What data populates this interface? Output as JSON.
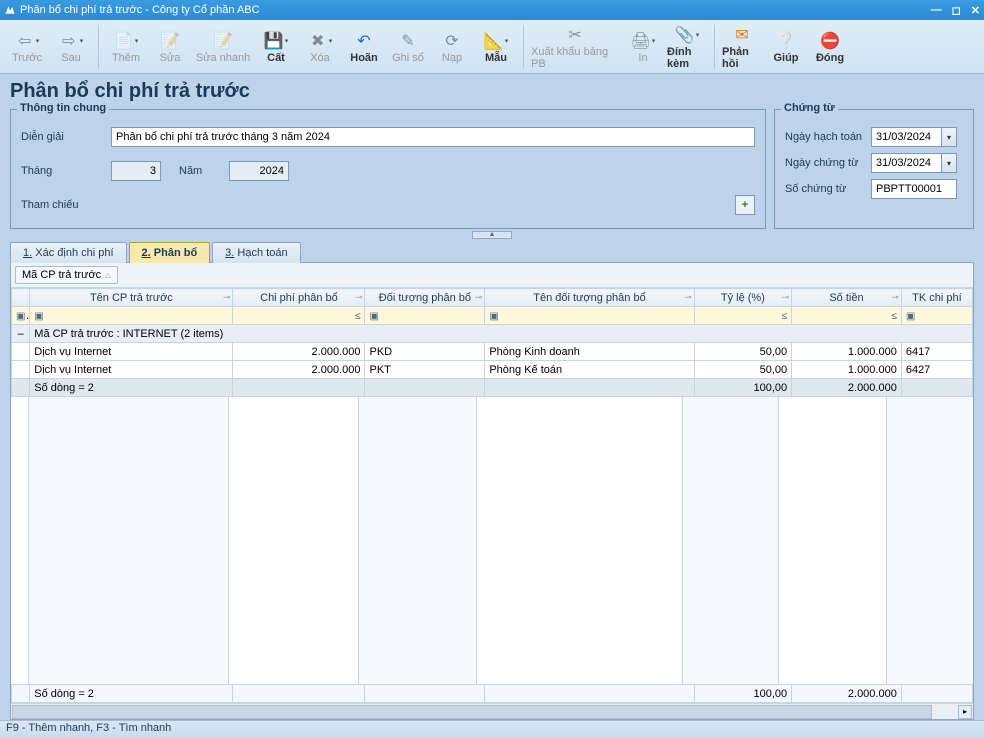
{
  "window": {
    "title": "Phân bổ chi phí trả trước - Công ty Cổ phần ABC"
  },
  "toolbar": {
    "prev": "Trước",
    "next": "Sau",
    "add": "Thêm",
    "edit": "Sửa",
    "quickedit": "Sửa nhanh",
    "cut": "Cất",
    "del": "Xóa",
    "undo": "Hoãn",
    "writebook": "Ghi sổ",
    "reload": "Nạp",
    "template": "Mẫu",
    "export": "Xuất khẩu bảng PB",
    "print": "In",
    "attach": "Đính kèm",
    "feedback": "Phản hồi",
    "help": "Giúp",
    "close": "Đóng"
  },
  "page": {
    "title": "Phân bổ chi phí trả trước"
  },
  "general": {
    "legend": "Thông tin chung",
    "desc_label": "Diễn giải",
    "desc": "Phân bổ chi phí trả trước tháng 3 năm 2024",
    "month_label": "Tháng",
    "month": "3",
    "year_label": "Năm",
    "year": "2024",
    "ref_label": "Tham chiếu"
  },
  "doc": {
    "legend": "Chứng từ",
    "acct_date_label": "Ngày hạch toán",
    "acct_date": "31/03/2024",
    "doc_date_label": "Ngày chứng từ",
    "doc_date": "31/03/2024",
    "doc_no_label": "Số chứng từ",
    "doc_no": "PBPTT00001"
  },
  "tabs": {
    "t1": "Xác định chi phí",
    "t1_key": "1.",
    "t2": "Phân bổ",
    "t2_key": "2.",
    "t3": "Hạch toán",
    "t3_key": "3."
  },
  "group": {
    "label": "Mã CP trả trước"
  },
  "columns": {
    "name": "Tên CP trả trước",
    "cost": "Chi phí phân bổ",
    "obj": "Đối tượng phân bổ",
    "objname": "Tên đối tượng phân bổ",
    "pct": "Tỷ lệ (%)",
    "amt": "Số tiền",
    "acct": "TK chi phí"
  },
  "filter": {
    "le": "≤",
    "sq": "▣"
  },
  "grouprow": {
    "text": "Mã CP trả trước : INTERNET (2 items)"
  },
  "rows": [
    {
      "name": "Dịch vụ Internet",
      "cost": "2.000.000",
      "obj": "PKD",
      "objname": "Phòng Kinh doanh",
      "pct": "50,00",
      "amt": "1.000.000",
      "acct": "6417"
    },
    {
      "name": "Dịch vụ Internet",
      "cost": "2.000.000",
      "obj": "PKT",
      "objname": "Phòng Kế toán",
      "pct": "50,00",
      "amt": "1.000.000",
      "acct": "6427"
    }
  ],
  "sumrow": {
    "label": "Số dòng = 2",
    "pct": "100,00",
    "amt": "2.000.000"
  },
  "footer": {
    "label": "Số dòng = 2",
    "pct": "100,00",
    "amt": "2.000.000"
  },
  "status": "F9 - Thêm nhanh, F3 - Tìm nhanh"
}
